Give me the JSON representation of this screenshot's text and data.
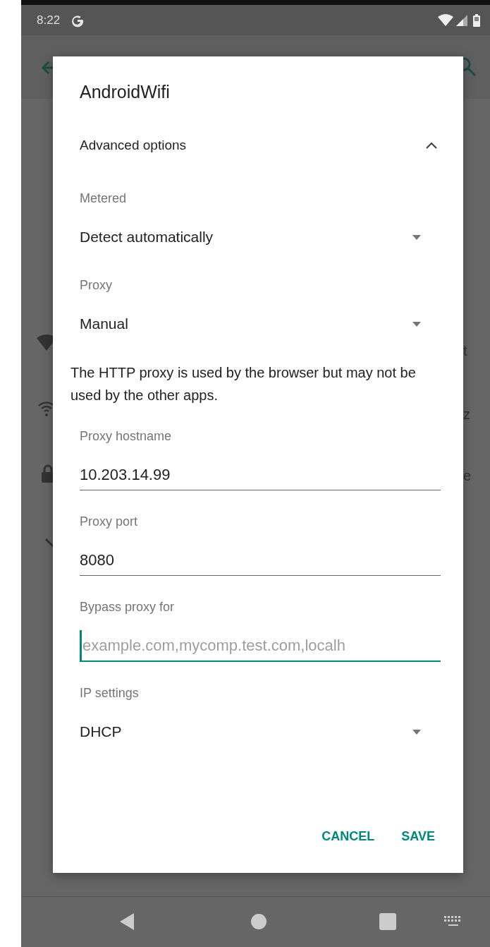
{
  "status_bar": {
    "time": "8:22"
  },
  "dialog": {
    "title": "AndroidWifi",
    "advanced_options": {
      "label": "Advanced options",
      "expanded": true
    },
    "settings": [
      {
        "kind": "select",
        "label": "Metered",
        "value": "Detect automatically"
      },
      {
        "kind": "select",
        "label": "Proxy",
        "value": "Manual"
      },
      {
        "kind": "note",
        "text": "The HTTP proxy is used by the browser but may not be used by the other apps."
      },
      {
        "kind": "text",
        "label": "Proxy hostname",
        "value": "10.203.14.99",
        "focused": false
      },
      {
        "kind": "text",
        "label": "Proxy port",
        "value": "8080",
        "focused": false
      },
      {
        "kind": "text",
        "label": "Bypass proxy for",
        "placeholder": "example.com,mycomp.test.com,localh",
        "focused": true
      },
      {
        "kind": "select",
        "label": "IP settings",
        "value": "DHCP"
      }
    ],
    "buttons": [
      "CANCEL",
      "SAVE"
    ]
  },
  "background_fragments": [
    "t",
    "z",
    "e"
  ]
}
